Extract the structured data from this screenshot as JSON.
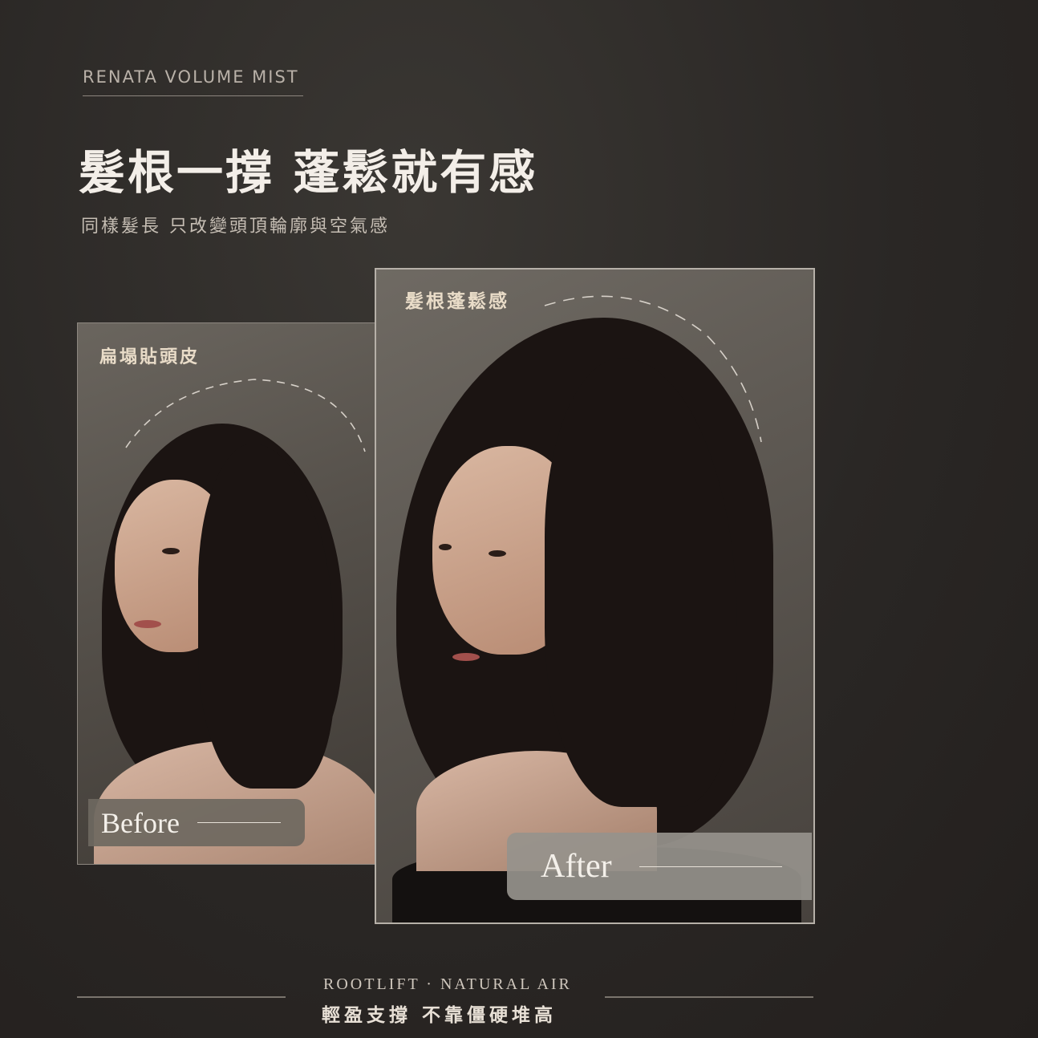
{
  "header": {
    "brand": "RENATA VOLUME MIST",
    "headline": "髮根一撐 蓬鬆就有感",
    "subline": "同樣髮長 只改變頭頂輪廓與空氣感"
  },
  "before_card": {
    "label": "扁塌貼頭皮",
    "tag": "Before"
  },
  "after_card": {
    "label": "髮根蓬鬆感",
    "tag": "After"
  },
  "footer": {
    "english": "ROOTLIFT · NATURAL AIR",
    "chinese": "輕盈支撐 不靠僵硬堆高"
  },
  "colors": {
    "background": "#2a2725",
    "accent_text": "#e9dcc8",
    "headline": "#f3eee8"
  }
}
